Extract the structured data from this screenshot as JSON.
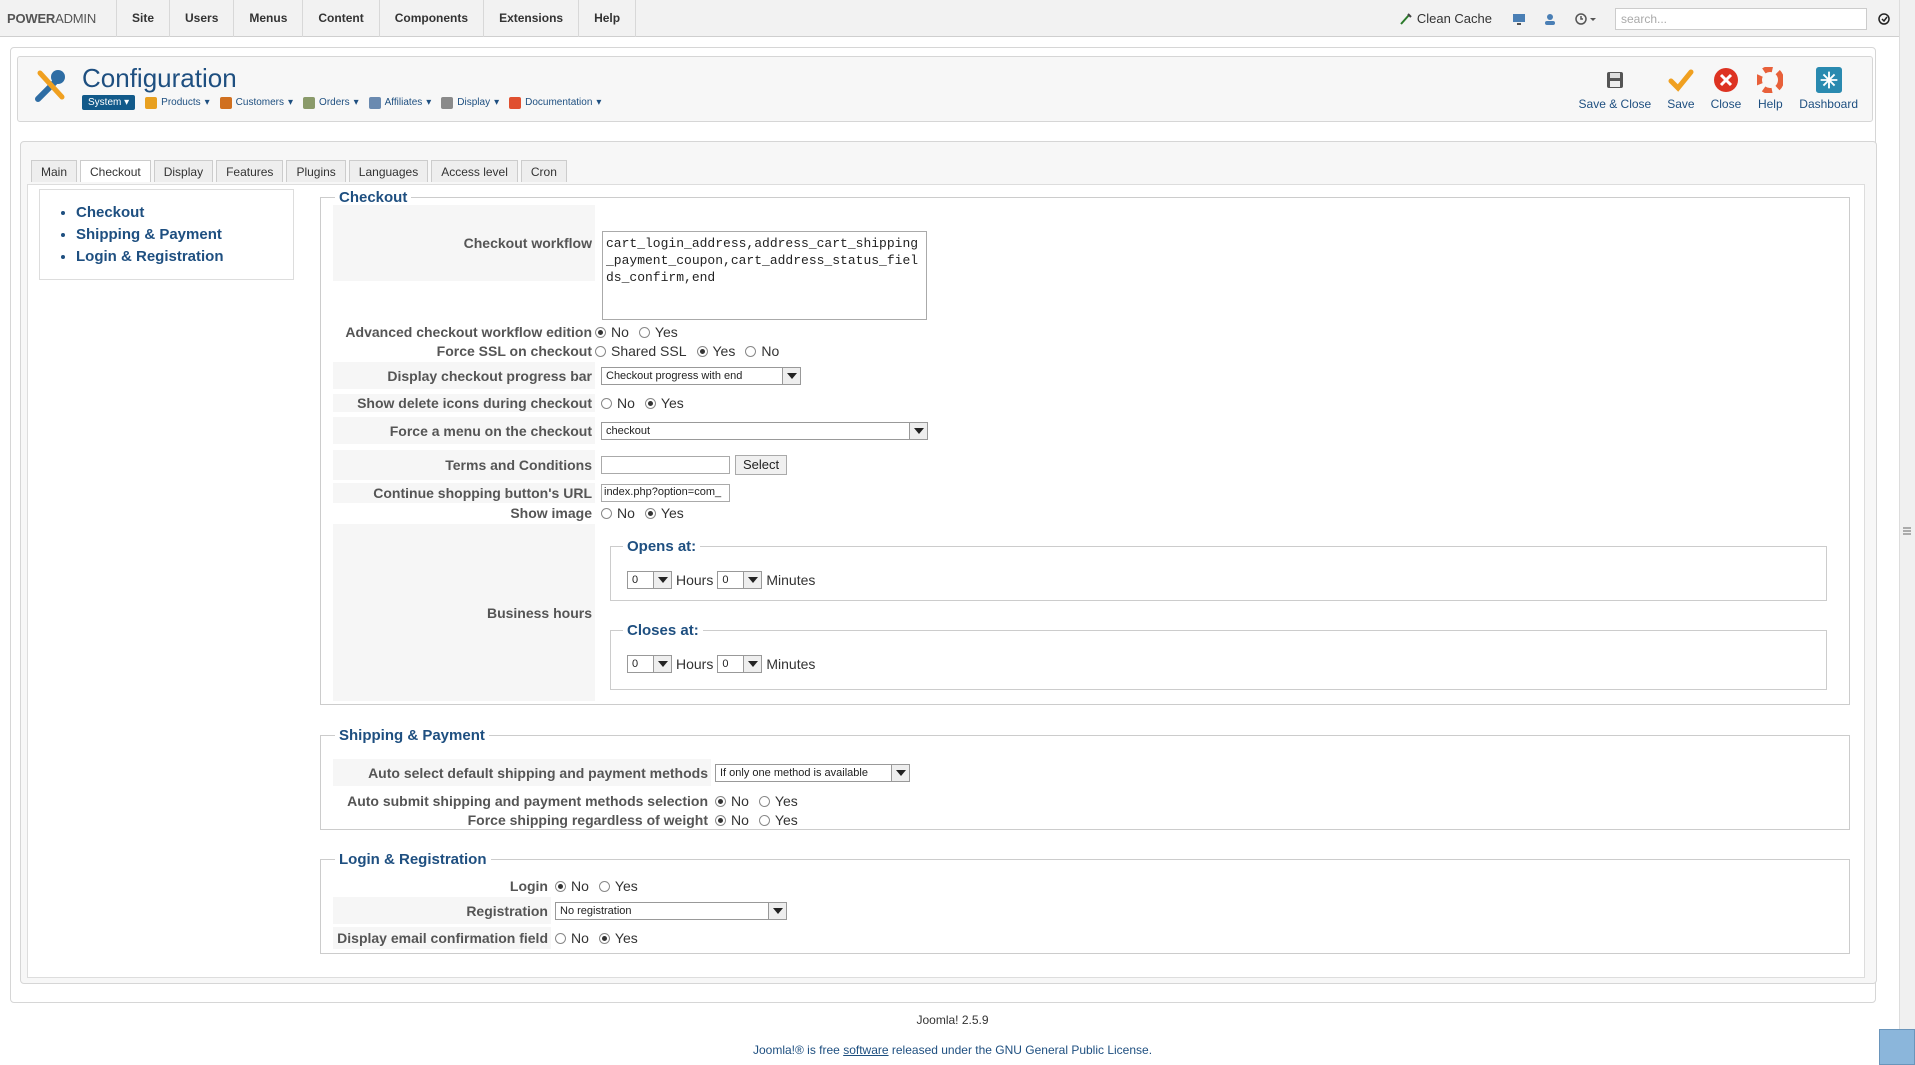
{
  "topbar": {
    "brand_a": "POWER",
    "brand_b": "ADMIN",
    "menu": [
      "Site",
      "Users",
      "Menus",
      "Content",
      "Components",
      "Extensions",
      "Help"
    ],
    "clean_cache": "Clean Cache",
    "search_placeholder": "search..."
  },
  "header": {
    "title": "Configuration",
    "submenu": {
      "system": "System",
      "products": "Products",
      "customers": "Customers",
      "orders": "Orders",
      "affiliates": "Affiliates",
      "display": "Display",
      "documentation": "Documentation"
    },
    "toolbar": {
      "save_close": "Save & Close",
      "save": "Save",
      "close": "Close",
      "help": "Help",
      "dashboard": "Dashboard"
    }
  },
  "tabs": [
    "Main",
    "Checkout",
    "Display",
    "Features",
    "Plugins",
    "Languages",
    "Access level",
    "Cron"
  ],
  "sidenav": [
    "Checkout",
    "Shipping & Payment",
    "Login & Registration"
  ],
  "checkout": {
    "legend": "Checkout",
    "workflow_label": "Checkout workflow",
    "workflow_value": "cart_login_address,address_cart_shipping_payment_coupon,cart_address_status_fields_confirm,end",
    "advanced_label": "Advanced checkout workflow edition",
    "force_ssl_label": "Force SSL on checkout",
    "progress_label": "Display checkout progress bar",
    "progress_value": "Checkout progress with end",
    "delete_icons_label": "Show delete icons during checkout",
    "force_menu_label": "Force a menu on the checkout",
    "force_menu_value": "checkout",
    "terms_label": "Terms and Conditions",
    "terms_button": "Select",
    "continue_label": "Continue shopping button's URL",
    "continue_value": "index.php?option=com_",
    "show_image_label": "Show image",
    "business_label": "Business hours",
    "opens_at": "Opens at:",
    "closes_at": "Closes at:",
    "hours": "Hours",
    "minutes": "Minutes",
    "zero": "0"
  },
  "options": {
    "no": "No",
    "yes": "Yes",
    "shared_ssl": "Shared SSL"
  },
  "shipping": {
    "legend": "Shipping & Payment",
    "auto_select_label": "Auto select default shipping and payment methods",
    "auto_select_value": "If only one method is available",
    "auto_submit_label": "Auto submit shipping and payment methods selection",
    "force_shipping_label": "Force shipping regardless of weight"
  },
  "login": {
    "legend": "Login & Registration",
    "login_label": "Login",
    "registration_label": "Registration",
    "registration_value": "No registration",
    "email_confirm_label": "Display email confirmation field"
  },
  "footer": {
    "version": "Joomla! 2.5.9",
    "license_a": "Joomla!® is free ",
    "license_link": "software",
    "license_b": " released under the GNU General Public License."
  }
}
